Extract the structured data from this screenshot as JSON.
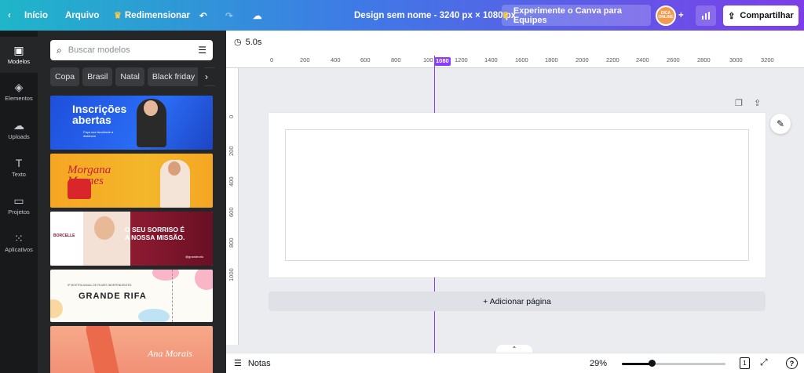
{
  "topbar": {
    "back_icon": "chevron-left-icon",
    "home_label": "Início",
    "file_label": "Arquivo",
    "resize_label": "Redimensionar",
    "design_title": "Design sem nome - 3240 px × 1080 px",
    "try_teams_label": "Experimente o Canva para Equipes",
    "avatar_text": "DICA ONLINE",
    "share_label": "Compartilhar",
    "gradient_start": "#1fb6c9",
    "gradient_end": "#7c3ee8"
  },
  "sidebar": {
    "items": [
      {
        "label": "Modelos",
        "icon": "templates-icon"
      },
      {
        "label": "Elementos",
        "icon": "elements-icon"
      },
      {
        "label": "Uploads",
        "icon": "upload-cloud-icon"
      },
      {
        "label": "Texto",
        "icon": "text-icon"
      },
      {
        "label": "Projetos",
        "icon": "folder-icon"
      },
      {
        "label": "Aplicativos",
        "icon": "apps-grid-icon"
      }
    ]
  },
  "panel": {
    "search_placeholder": "Buscar modelos",
    "chips": [
      "Copa",
      "Brasil",
      "Natal",
      "Black friday",
      "C"
    ],
    "templates": [
      {
        "title": "Inscrições abertas",
        "subtitle": "Faça sua faculdade a distância"
      },
      {
        "title": "Morgana Mornes"
      },
      {
        "title": "O SEU SORRISO É A NOSSA MISSÃO.",
        "brand": "BORCELLE",
        "handle": "@grandeorlo"
      },
      {
        "title": "GRANDE RIFA",
        "kicker": "5ª MOSTRA ANUAL DE FILMES INDEPENDENTES"
      },
      {
        "title": "Ana Morais"
      }
    ]
  },
  "canvas": {
    "duration": "5.0s",
    "ruler_h_ticks": [
      "0",
      "200",
      "400",
      "600",
      "800",
      "100",
      "1200",
      "1400",
      "1600",
      "1800",
      "2000",
      "2200",
      "2400",
      "2600",
      "2800",
      "3000",
      "3200"
    ],
    "ruler_v_ticks": [
      "0",
      "200",
      "400",
      "600",
      "800",
      "1000"
    ],
    "cursor_value": "1080",
    "add_page_label": "+ Adicionar página",
    "accent": "#8b3dff"
  },
  "bottombar": {
    "notes_label": "Notas",
    "zoom": "29%",
    "zoom_fraction": 0.29,
    "page_count": "1",
    "help_label": "?"
  }
}
